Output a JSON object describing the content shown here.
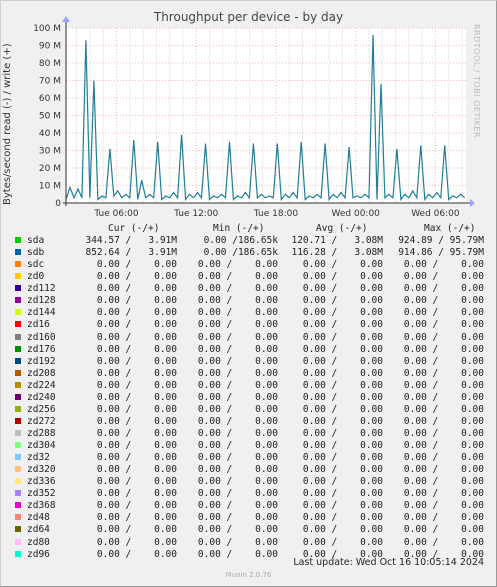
{
  "title": "Throughput per device - by day",
  "ylabel": "Bytes/second read (-) / write (+)",
  "rrdtool": "RRDTOOL / TOBI OETIKER",
  "headers": {
    "cur": "Cur (-/+)",
    "min": "Min (-/+)",
    "avg": "Avg (-/+)",
    "max": "Max (-/+)"
  },
  "rows": [
    {
      "name": "sda",
      "color": "#00cc00",
      "cur": "344.57 /   3.91M",
      "min": "0.00 /186.65k",
      "avg": "120.71 /   3.08M",
      "max": "924.89 / 95.79M"
    },
    {
      "name": "sdb",
      "color": "#0066b3",
      "cur": "852.64 /   3.91M",
      "min": "0.00 /186.65k",
      "avg": "116.28 /   3.08M",
      "max": "914.86 / 95.79M"
    },
    {
      "name": "sdc",
      "color": "#ff8000",
      "cur": "0.00 /    0.00",
      "min": "0.00 /    0.00",
      "avg": "0.00 /    0.00",
      "max": "0.00 /    0.00"
    },
    {
      "name": "zd0",
      "color": "#ffcc00",
      "cur": "0.00 /    0.00",
      "min": "0.00 /    0.00",
      "avg": "0.00 /    0.00",
      "max": "0.00 /    0.00"
    },
    {
      "name": "zd112",
      "color": "#330099",
      "cur": "0.00 /    0.00",
      "min": "0.00 /    0.00",
      "avg": "0.00 /    0.00",
      "max": "0.00 /    0.00"
    },
    {
      "name": "zd128",
      "color": "#990099",
      "cur": "0.00 /    0.00",
      "min": "0.00 /    0.00",
      "avg": "0.00 /    0.00",
      "max": "0.00 /    0.00"
    },
    {
      "name": "zd144",
      "color": "#ccff00",
      "cur": "0.00 /    0.00",
      "min": "0.00 /    0.00",
      "avg": "0.00 /    0.00",
      "max": "0.00 /    0.00"
    },
    {
      "name": "zd16",
      "color": "#ff0000",
      "cur": "0.00 /    0.00",
      "min": "0.00 /    0.00",
      "avg": "0.00 /    0.00",
      "max": "0.00 /    0.00"
    },
    {
      "name": "zd160",
      "color": "#808080",
      "cur": "0.00 /    0.00",
      "min": "0.00 /    0.00",
      "avg": "0.00 /    0.00",
      "max": "0.00 /    0.00"
    },
    {
      "name": "zd176",
      "color": "#008f00",
      "cur": "0.00 /    0.00",
      "min": "0.00 /    0.00",
      "avg": "0.00 /    0.00",
      "max": "0.00 /    0.00"
    },
    {
      "name": "zd192",
      "color": "#00487d",
      "cur": "0.00 /    0.00",
      "min": "0.00 /    0.00",
      "avg": "0.00 /    0.00",
      "max": "0.00 /    0.00"
    },
    {
      "name": "zd208",
      "color": "#b35a00",
      "cur": "0.00 /    0.00",
      "min": "0.00 /    0.00",
      "avg": "0.00 /    0.00",
      "max": "0.00 /    0.00"
    },
    {
      "name": "zd224",
      "color": "#b38f00",
      "cur": "0.00 /    0.00",
      "min": "0.00 /    0.00",
      "avg": "0.00 /    0.00",
      "max": "0.00 /    0.00"
    },
    {
      "name": "zd240",
      "color": "#6b006b",
      "cur": "0.00 /    0.00",
      "min": "0.00 /    0.00",
      "avg": "0.00 /    0.00",
      "max": "0.00 /    0.00"
    },
    {
      "name": "zd256",
      "color": "#8fb300",
      "cur": "0.00 /    0.00",
      "min": "0.00 /    0.00",
      "avg": "0.00 /    0.00",
      "max": "0.00 /    0.00"
    },
    {
      "name": "zd272",
      "color": "#b30000",
      "cur": "0.00 /    0.00",
      "min": "0.00 /    0.00",
      "avg": "0.00 /    0.00",
      "max": "0.00 /    0.00"
    },
    {
      "name": "zd288",
      "color": "#bebebe",
      "cur": "0.00 /    0.00",
      "min": "0.00 /    0.00",
      "avg": "0.00 /    0.00",
      "max": "0.00 /    0.00"
    },
    {
      "name": "zd304",
      "color": "#80ff80",
      "cur": "0.00 /    0.00",
      "min": "0.00 /    0.00",
      "avg": "0.00 /    0.00",
      "max": "0.00 /    0.00"
    },
    {
      "name": "zd32",
      "color": "#80c9ff",
      "cur": "0.00 /    0.00",
      "min": "0.00 /    0.00",
      "avg": "0.00 /    0.00",
      "max": "0.00 /    0.00"
    },
    {
      "name": "zd320",
      "color": "#ffc080",
      "cur": "0.00 /    0.00",
      "min": "0.00 /    0.00",
      "avg": "0.00 /    0.00",
      "max": "0.00 /    0.00"
    },
    {
      "name": "zd336",
      "color": "#ffe680",
      "cur": "0.00 /    0.00",
      "min": "0.00 /    0.00",
      "avg": "0.00 /    0.00",
      "max": "0.00 /    0.00"
    },
    {
      "name": "zd352",
      "color": "#aa80ff",
      "cur": "0.00 /    0.00",
      "min": "0.00 /    0.00",
      "avg": "0.00 /    0.00",
      "max": "0.00 /    0.00"
    },
    {
      "name": "zd368",
      "color": "#ee00cc",
      "cur": "0.00 /    0.00",
      "min": "0.00 /    0.00",
      "avg": "0.00 /    0.00",
      "max": "0.00 /    0.00"
    },
    {
      "name": "zd48",
      "color": "#ff8080",
      "cur": "0.00 /    0.00",
      "min": "0.00 /    0.00",
      "avg": "0.00 /    0.00",
      "max": "0.00 /    0.00"
    },
    {
      "name": "zd64",
      "color": "#666600",
      "cur": "0.00 /    0.00",
      "min": "0.00 /    0.00",
      "avg": "0.00 /    0.00",
      "max": "0.00 /    0.00"
    },
    {
      "name": "zd80",
      "color": "#ffbfff",
      "cur": "0.00 /    0.00",
      "min": "0.00 /    0.00",
      "avg": "0.00 /    0.00",
      "max": "0.00 /    0.00"
    },
    {
      "name": "zd96",
      "color": "#00ffcc",
      "cur": "0.00 /    0.00",
      "min": "0.00 /    0.00",
      "avg": "0.00 /    0.00",
      "max": "0.00 /    0.00"
    }
  ],
  "last_update": "Last update: Wed Oct 16 10:05:14 2024",
  "version": "Munin 2.0.76",
  "chart_data": {
    "type": "area",
    "title": "Throughput per device - by day",
    "ylabel": "Bytes/second read (-) / write (+)",
    "ylim": [
      0,
      100
    ],
    "y_unit": "M",
    "yticks": [
      {
        "value": 0,
        "label": "0"
      },
      {
        "value": 10,
        "label": "10 M"
      },
      {
        "value": 20,
        "label": "20 M"
      },
      {
        "value": 30,
        "label": "30 M"
      },
      {
        "value": 40,
        "label": "40 M"
      },
      {
        "value": 50,
        "label": "50 M"
      },
      {
        "value": 60,
        "label": "60 M"
      },
      {
        "value": 70,
        "label": "70 M"
      },
      {
        "value": 80,
        "label": "80 M"
      },
      {
        "value": 90,
        "label": "90 M"
      },
      {
        "value": 100,
        "label": "100 M"
      }
    ],
    "xlim": [
      2.2,
      32.3
    ],
    "x_unit": "hours",
    "xticks": [
      {
        "value": 6,
        "label": "Tue 06:00"
      },
      {
        "value": 12,
        "label": "Tue 12:00"
      },
      {
        "value": 18,
        "label": "Tue 18:00"
      },
      {
        "value": 24,
        "label": "Wed 00:00"
      },
      {
        "value": 30,
        "label": "Wed 06:00"
      }
    ],
    "grid": true,
    "series": [
      {
        "name": "sda",
        "color": "#00cc00",
        "x": [
          2.2,
          2.5,
          2.8,
          3.1,
          3.4,
          3.7,
          4.0,
          4.3,
          4.6,
          4.9,
          5.2,
          5.5,
          5.8,
          6.1,
          6.4,
          6.7,
          7.0,
          7.3,
          7.6,
          7.9,
          8.2,
          8.5,
          8.8,
          9.1,
          9.4,
          9.7,
          10.0,
          10.3,
          10.6,
          10.9,
          11.2,
          11.5,
          11.8,
          12.1,
          12.4,
          12.7,
          13.0,
          13.3,
          13.6,
          13.9,
          14.2,
          14.5,
          14.8,
          15.1,
          15.4,
          15.7,
          16.0,
          16.3,
          16.6,
          16.9,
          17.2,
          17.5,
          17.8,
          18.1,
          18.4,
          18.7,
          19.0,
          19.3,
          19.6,
          19.9,
          20.2,
          20.5,
          20.8,
          21.1,
          21.4,
          21.7,
          22.0,
          22.3,
          22.6,
          22.9,
          23.2,
          23.5,
          23.8,
          24.1,
          24.4,
          24.7,
          25.0,
          25.3,
          25.6,
          25.9,
          26.2,
          26.5,
          26.8,
          27.1,
          27.4,
          27.7,
          28.0,
          28.3,
          28.6,
          28.9,
          29.2,
          29.5,
          29.8,
          30.1,
          30.4,
          30.7,
          31.0,
          31.3,
          31.6,
          31.9,
          32.2
        ],
        "y": [
          2,
          9,
          3,
          8,
          3,
          93,
          3,
          70,
          2,
          4,
          3,
          31,
          4,
          7,
          3,
          5,
          3,
          36,
          2,
          13,
          3,
          5,
          3,
          35,
          2,
          4,
          3,
          6,
          3,
          39,
          2,
          5,
          3,
          6,
          3,
          34,
          2,
          4,
          3,
          5,
          3,
          35,
          2,
          4,
          3,
          6,
          3,
          34,
          3,
          5,
          3,
          4,
          3,
          34,
          2,
          5,
          3,
          6,
          3,
          35,
          2,
          4,
          3,
          5,
          3,
          34,
          2,
          5,
          3,
          6,
          3,
          32,
          3,
          4,
          3,
          5,
          3,
          96,
          2,
          68,
          3,
          5,
          3,
          31,
          2,
          5,
          3,
          7,
          3,
          33,
          2,
          5,
          3,
          6,
          3,
          33,
          2,
          4,
          3,
          5,
          3
        ]
      }
    ]
  }
}
